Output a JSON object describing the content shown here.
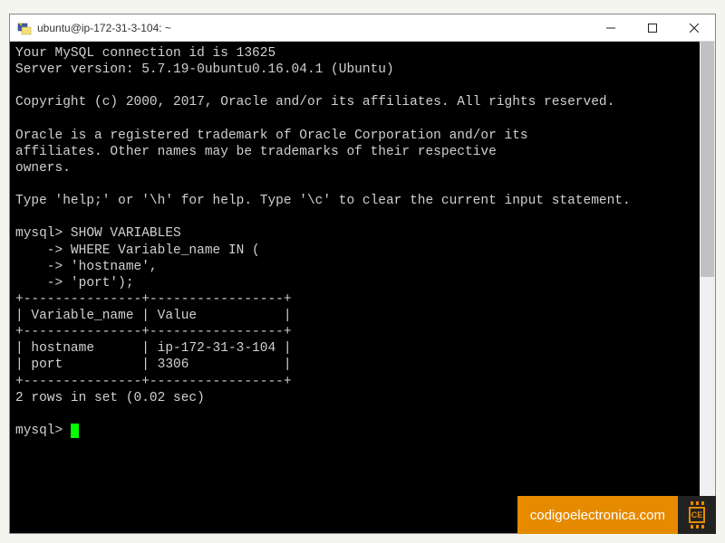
{
  "window": {
    "title": "ubuntu@ip-172-31-3-104: ~"
  },
  "terminal": {
    "lines": {
      "conn_id": "Your MySQL connection id is 13625",
      "server_ver": "Server version: 5.7.19-0ubuntu0.16.04.1 (Ubuntu)",
      "blank1": "",
      "copyright": "Copyright (c) 2000, 2017, Oracle and/or its affiliates. All rights reserved.",
      "blank2": "",
      "trademark1": "Oracle is a registered trademark of Oracle Corporation and/or its",
      "trademark2": "affiliates. Other names may be trademarks of their respective",
      "trademark3": "owners.",
      "blank3": "",
      "help": "Type 'help;' or '\\h' for help. Type '\\c' to clear the current input statement.",
      "blank4": "",
      "prompt1": "mysql> SHOW VARIABLES",
      "prompt2": "    -> WHERE Variable_name IN (",
      "prompt3": "    -> 'hostname',",
      "prompt4": "    -> 'port');",
      "tbl_top": "+---------------+-----------------+",
      "tbl_header": "| Variable_name | Value           |",
      "tbl_sep": "+---------------+-----------------+",
      "tbl_row1": "| hostname      | ip-172-31-3-104 |",
      "tbl_row2": "| port          | 3306            |",
      "tbl_bot": "+---------------+-----------------+",
      "rows": "2 rows in set (0.02 sec)",
      "blank5": "",
      "prompt_cur": "mysql> "
    }
  },
  "watermark": {
    "text": "codigoelectronica.com",
    "logo_text": "CE"
  }
}
